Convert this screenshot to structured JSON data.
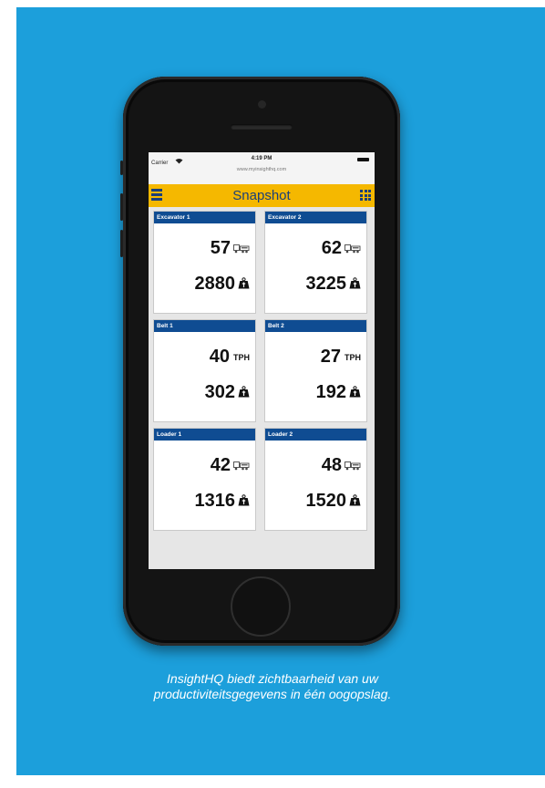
{
  "status": {
    "carrier": "Carrier",
    "time": "4:19 PM",
    "url": "www.myinsighthq.com"
  },
  "app": {
    "title": "Snapshot"
  },
  "cards": [
    {
      "title": "Excavator 1",
      "primary": "57",
      "primary_unit": "truck-icon",
      "secondary": "2880",
      "secondary_unit": "tonne-weight-icon"
    },
    {
      "title": "Excavator 2",
      "primary": "62",
      "primary_unit": "truck-icon",
      "secondary": "3225",
      "secondary_unit": "tonne-weight-icon"
    },
    {
      "title": "Belt 1",
      "primary": "40",
      "primary_unit_label": "TPH",
      "secondary": "302",
      "secondary_unit": "tonne-weight-icon"
    },
    {
      "title": "Belt 2",
      "primary": "27",
      "primary_unit_label": "TPH",
      "secondary": "192",
      "secondary_unit": "tonne-weight-icon"
    },
    {
      "title": "Loader 1",
      "primary": "42",
      "primary_unit": "truck-icon",
      "secondary": "1316",
      "secondary_unit": "tonne-weight-icon"
    },
    {
      "title": "Loader 2",
      "primary": "48",
      "primary_unit": "truck-icon",
      "secondary": "1520",
      "secondary_unit": "tonne-weight-icon"
    }
  ],
  "caption": {
    "line1": "InsightHQ biedt zichtbaarheid van uw",
    "line2": "productiviteitsgegevens in één oogopslag."
  },
  "colors": {
    "background": "#1c9fdb",
    "appbar": "#f5b800",
    "card_header": "#0f4c92",
    "title": "#1a3f7a"
  }
}
